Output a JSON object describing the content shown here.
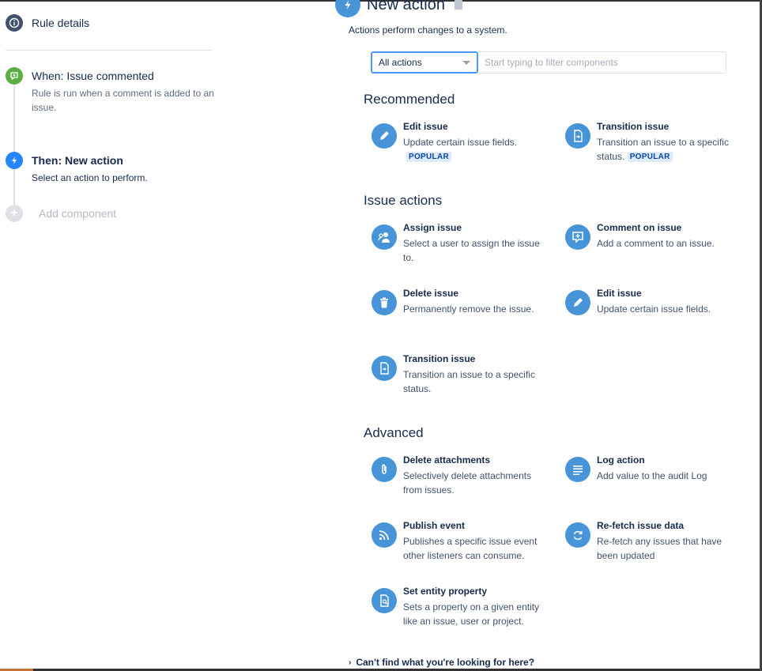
{
  "sidebar": {
    "rule_details": "Rule details",
    "trigger": {
      "title": "When: Issue commented",
      "description": "Rule is run when a comment is added to an issue."
    },
    "action": {
      "title": "Then: New action",
      "description": "Select an action to perform."
    },
    "add_component": "Add component"
  },
  "main": {
    "title": "New action",
    "intro": "Actions perform changes to a system.",
    "filter": {
      "selected": "All actions",
      "placeholder": "Start typing to filter components"
    },
    "sections": {
      "recommended": {
        "title": "Recommended",
        "items": [
          {
            "title": "Edit issue",
            "description": "Update certain issue fields.",
            "badge": "POPULAR",
            "icon": "pencil-icon"
          },
          {
            "title": "Transition issue",
            "description": "Transition an issue to a specific status.",
            "badge": "POPULAR",
            "icon": "transition-icon"
          }
        ]
      },
      "issue_actions": {
        "title": "Issue actions",
        "items": [
          {
            "title": "Assign issue",
            "description": "Select a user to assign the issue to.",
            "icon": "assign-user-icon"
          },
          {
            "title": "Comment on issue",
            "description": "Add a comment to an issue.",
            "icon": "comment-icon"
          },
          {
            "title": "Delete issue",
            "description": "Permanently remove the issue.",
            "icon": "trash-icon"
          },
          {
            "title": "Edit issue",
            "description": "Update certain issue fields.",
            "icon": "pencil-icon"
          },
          {
            "title": "Transition issue",
            "description": "Transition an issue to a specific status.",
            "icon": "transition-icon"
          }
        ]
      },
      "advanced": {
        "title": "Advanced",
        "items": [
          {
            "title": "Delete attachments",
            "description": "Selectively delete attachments from issues.",
            "icon": "paperclip-icon"
          },
          {
            "title": "Log action",
            "description": "Add value to the audit Log",
            "icon": "log-icon"
          },
          {
            "title": "Publish event",
            "description": "Publishes a specific issue event other listeners can consume.",
            "icon": "rss-icon"
          },
          {
            "title": "Re-fetch issue data",
            "description": "Re-fetch any issues that have been updated",
            "icon": "refresh-icon"
          },
          {
            "title": "Set entity property",
            "description": "Sets a property on a given entity like an issue, user or project.",
            "icon": "entity-property-icon"
          }
        ]
      }
    },
    "cant_find": "Can't find what you're looking for here?"
  },
  "colors": {
    "accent": "#4794d9",
    "trigger": "#5aac44",
    "action": "#2684ff",
    "rule_details": "#42526e",
    "badge_bg": "#deebff",
    "badge_text": "#0747a6"
  }
}
